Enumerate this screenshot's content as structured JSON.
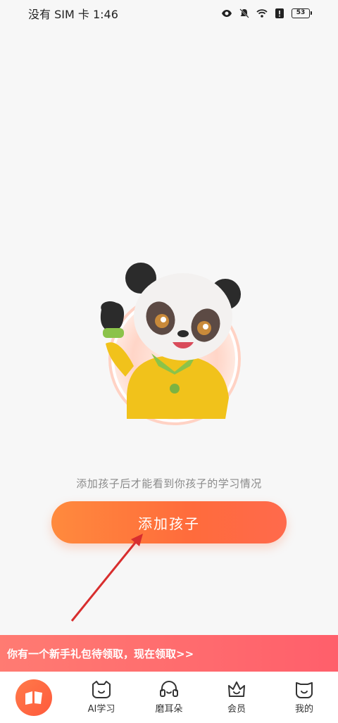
{
  "status": {
    "carrier_time": "没有 SIM 卡 1:46",
    "battery": "53"
  },
  "main": {
    "hint": "添加孩子后才能看到你孩子的学习情况",
    "add_child_label": "添加孩子"
  },
  "promo": {
    "text": "你有一个新手礼包待领取，现在领取>>"
  },
  "nav": {
    "items": [
      {
        "label": "",
        "icon": "open-book-icon"
      },
      {
        "label": "AI学习",
        "icon": "cat-face-icon"
      },
      {
        "label": "磨耳朵",
        "icon": "headphones-icon"
      },
      {
        "label": "会员",
        "icon": "crown-icon"
      },
      {
        "label": "我的",
        "icon": "profile-face-icon"
      }
    ]
  },
  "colors": {
    "accent": "#ff6b3c",
    "banner": "#ff6b6b"
  }
}
